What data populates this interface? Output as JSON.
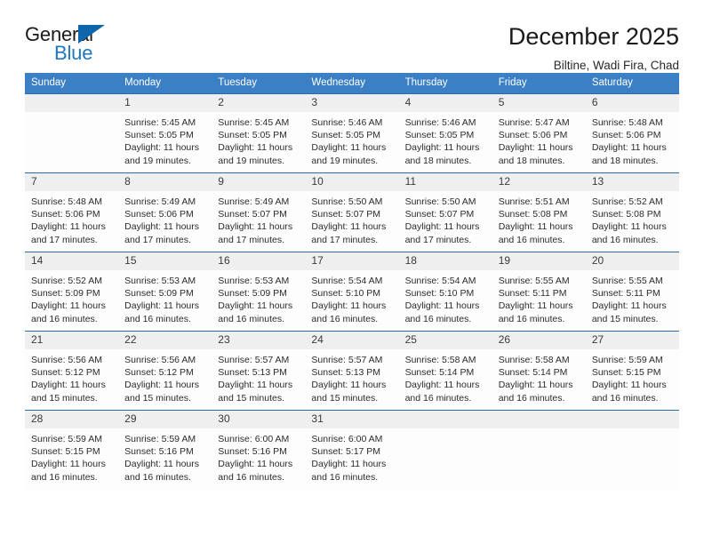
{
  "brand": {
    "word_one": "General",
    "word_two": "Blue",
    "triangle_color": "#1066ad",
    "blue_text_color": "#1f77c2"
  },
  "header": {
    "title": "December 2025",
    "location": "Biltine, Wadi Fira, Chad"
  },
  "theme": {
    "header_row_bg": "#3b7fc4",
    "row_divider": "#2b6ca8",
    "daynum_bg": "#efefef",
    "cell_bg": "#fdfdfd"
  },
  "calendar": {
    "weekdays": [
      "Sunday",
      "Monday",
      "Tuesday",
      "Wednesday",
      "Thursday",
      "Friday",
      "Saturday"
    ],
    "labels": {
      "sunrise": "Sunrise:",
      "sunset": "Sunset:",
      "daylight": "Daylight:"
    },
    "weeks": [
      [
        {
          "day": "",
          "sunrise": "",
          "sunset": "",
          "daylight": ""
        },
        {
          "day": "1",
          "sunrise": "Sunrise: 5:45 AM",
          "sunset": "Sunset: 5:05 PM",
          "daylight": "Daylight: 11 hours and 19 minutes."
        },
        {
          "day": "2",
          "sunrise": "Sunrise: 5:45 AM",
          "sunset": "Sunset: 5:05 PM",
          "daylight": "Daylight: 11 hours and 19 minutes."
        },
        {
          "day": "3",
          "sunrise": "Sunrise: 5:46 AM",
          "sunset": "Sunset: 5:05 PM",
          "daylight": "Daylight: 11 hours and 19 minutes."
        },
        {
          "day": "4",
          "sunrise": "Sunrise: 5:46 AM",
          "sunset": "Sunset: 5:05 PM",
          "daylight": "Daylight: 11 hours and 18 minutes."
        },
        {
          "day": "5",
          "sunrise": "Sunrise: 5:47 AM",
          "sunset": "Sunset: 5:06 PM",
          "daylight": "Daylight: 11 hours and 18 minutes."
        },
        {
          "day": "6",
          "sunrise": "Sunrise: 5:48 AM",
          "sunset": "Sunset: 5:06 PM",
          "daylight": "Daylight: 11 hours and 18 minutes."
        }
      ],
      [
        {
          "day": "7",
          "sunrise": "Sunrise: 5:48 AM",
          "sunset": "Sunset: 5:06 PM",
          "daylight": "Daylight: 11 hours and 17 minutes."
        },
        {
          "day": "8",
          "sunrise": "Sunrise: 5:49 AM",
          "sunset": "Sunset: 5:06 PM",
          "daylight": "Daylight: 11 hours and 17 minutes."
        },
        {
          "day": "9",
          "sunrise": "Sunrise: 5:49 AM",
          "sunset": "Sunset: 5:07 PM",
          "daylight": "Daylight: 11 hours and 17 minutes."
        },
        {
          "day": "10",
          "sunrise": "Sunrise: 5:50 AM",
          "sunset": "Sunset: 5:07 PM",
          "daylight": "Daylight: 11 hours and 17 minutes."
        },
        {
          "day": "11",
          "sunrise": "Sunrise: 5:50 AM",
          "sunset": "Sunset: 5:07 PM",
          "daylight": "Daylight: 11 hours and 17 minutes."
        },
        {
          "day": "12",
          "sunrise": "Sunrise: 5:51 AM",
          "sunset": "Sunset: 5:08 PM",
          "daylight": "Daylight: 11 hours and 16 minutes."
        },
        {
          "day": "13",
          "sunrise": "Sunrise: 5:52 AM",
          "sunset": "Sunset: 5:08 PM",
          "daylight": "Daylight: 11 hours and 16 minutes."
        }
      ],
      [
        {
          "day": "14",
          "sunrise": "Sunrise: 5:52 AM",
          "sunset": "Sunset: 5:09 PM",
          "daylight": "Daylight: 11 hours and 16 minutes."
        },
        {
          "day": "15",
          "sunrise": "Sunrise: 5:53 AM",
          "sunset": "Sunset: 5:09 PM",
          "daylight": "Daylight: 11 hours and 16 minutes."
        },
        {
          "day": "16",
          "sunrise": "Sunrise: 5:53 AM",
          "sunset": "Sunset: 5:09 PM",
          "daylight": "Daylight: 11 hours and 16 minutes."
        },
        {
          "day": "17",
          "sunrise": "Sunrise: 5:54 AM",
          "sunset": "Sunset: 5:10 PM",
          "daylight": "Daylight: 11 hours and 16 minutes."
        },
        {
          "day": "18",
          "sunrise": "Sunrise: 5:54 AM",
          "sunset": "Sunset: 5:10 PM",
          "daylight": "Daylight: 11 hours and 16 minutes."
        },
        {
          "day": "19",
          "sunrise": "Sunrise: 5:55 AM",
          "sunset": "Sunset: 5:11 PM",
          "daylight": "Daylight: 11 hours and 16 minutes."
        },
        {
          "day": "20",
          "sunrise": "Sunrise: 5:55 AM",
          "sunset": "Sunset: 5:11 PM",
          "daylight": "Daylight: 11 hours and 15 minutes."
        }
      ],
      [
        {
          "day": "21",
          "sunrise": "Sunrise: 5:56 AM",
          "sunset": "Sunset: 5:12 PM",
          "daylight": "Daylight: 11 hours and 15 minutes."
        },
        {
          "day": "22",
          "sunrise": "Sunrise: 5:56 AM",
          "sunset": "Sunset: 5:12 PM",
          "daylight": "Daylight: 11 hours and 15 minutes."
        },
        {
          "day": "23",
          "sunrise": "Sunrise: 5:57 AM",
          "sunset": "Sunset: 5:13 PM",
          "daylight": "Daylight: 11 hours and 15 minutes."
        },
        {
          "day": "24",
          "sunrise": "Sunrise: 5:57 AM",
          "sunset": "Sunset: 5:13 PM",
          "daylight": "Daylight: 11 hours and 15 minutes."
        },
        {
          "day": "25",
          "sunrise": "Sunrise: 5:58 AM",
          "sunset": "Sunset: 5:14 PM",
          "daylight": "Daylight: 11 hours and 16 minutes."
        },
        {
          "day": "26",
          "sunrise": "Sunrise: 5:58 AM",
          "sunset": "Sunset: 5:14 PM",
          "daylight": "Daylight: 11 hours and 16 minutes."
        },
        {
          "day": "27",
          "sunrise": "Sunrise: 5:59 AM",
          "sunset": "Sunset: 5:15 PM",
          "daylight": "Daylight: 11 hours and 16 minutes."
        }
      ],
      [
        {
          "day": "28",
          "sunrise": "Sunrise: 5:59 AM",
          "sunset": "Sunset: 5:15 PM",
          "daylight": "Daylight: 11 hours and 16 minutes."
        },
        {
          "day": "29",
          "sunrise": "Sunrise: 5:59 AM",
          "sunset": "Sunset: 5:16 PM",
          "daylight": "Daylight: 11 hours and 16 minutes."
        },
        {
          "day": "30",
          "sunrise": "Sunrise: 6:00 AM",
          "sunset": "Sunset: 5:16 PM",
          "daylight": "Daylight: 11 hours and 16 minutes."
        },
        {
          "day": "31",
          "sunrise": "Sunrise: 6:00 AM",
          "sunset": "Sunset: 5:17 PM",
          "daylight": "Daylight: 11 hours and 16 minutes."
        },
        {
          "day": "",
          "sunrise": "",
          "sunset": "",
          "daylight": ""
        },
        {
          "day": "",
          "sunrise": "",
          "sunset": "",
          "daylight": ""
        },
        {
          "day": "",
          "sunrise": "",
          "sunset": "",
          "daylight": ""
        }
      ]
    ]
  }
}
